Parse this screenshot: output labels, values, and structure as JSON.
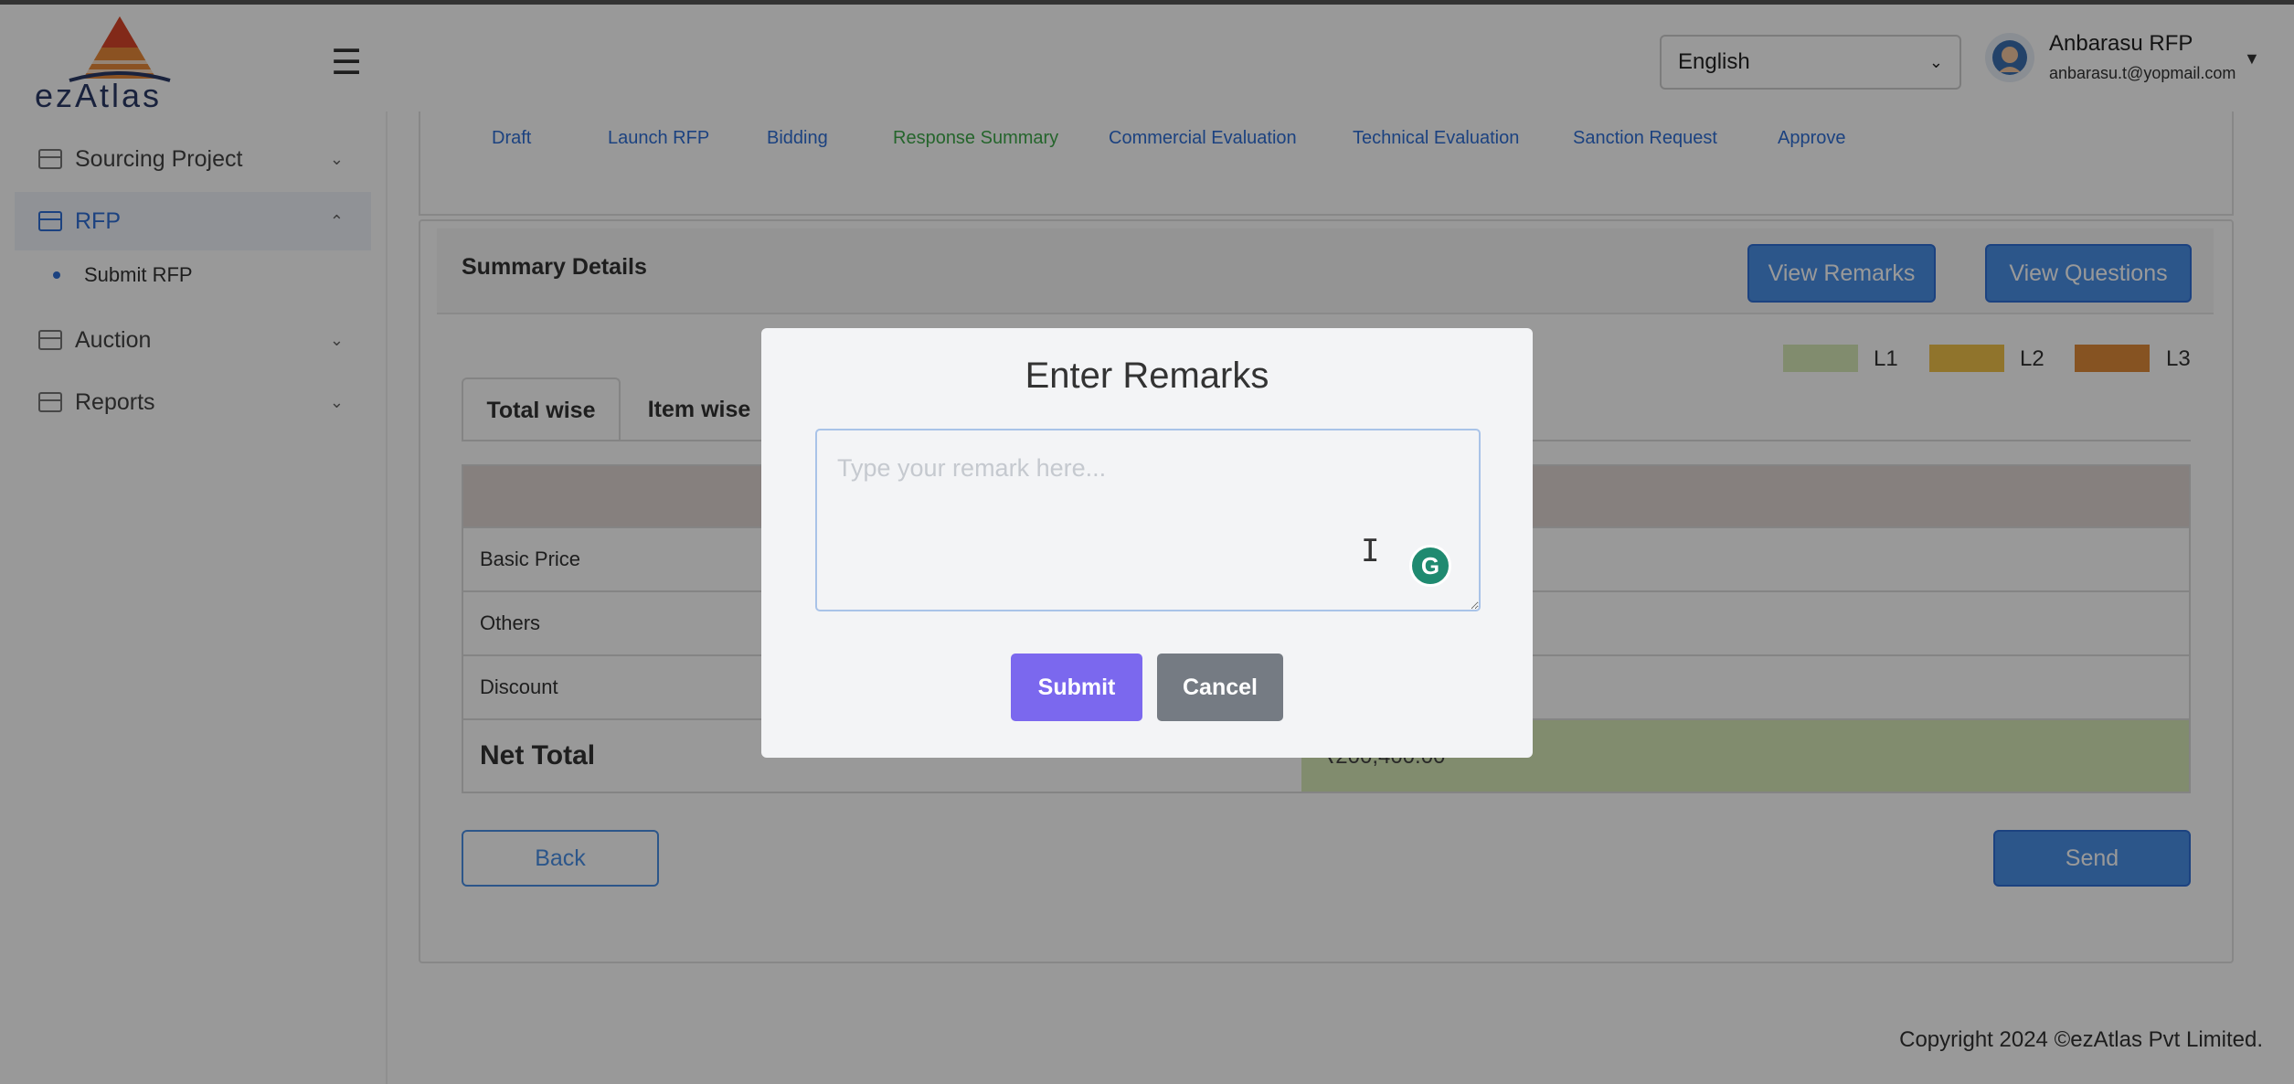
{
  "header": {
    "logo_text": "ezAtlas",
    "language": "English",
    "user_name": "Anbarasu RFP",
    "user_email": "anbarasu.t@yopmail.com"
  },
  "sidebar": {
    "items": [
      {
        "label": "Sourcing Project",
        "icon": "table-icon",
        "chevron": "chevron-down-icon"
      },
      {
        "label": "RFP",
        "icon": "table-icon",
        "chevron": "chevron-up-icon",
        "active": true
      },
      {
        "label": "Auction",
        "icon": "table-icon",
        "chevron": "chevron-down-icon"
      },
      {
        "label": "Reports",
        "icon": "table-icon",
        "chevron": "chevron-down-icon"
      }
    ],
    "sub_item": "Submit RFP"
  },
  "steps": [
    "Draft",
    "Launch RFP",
    "Bidding",
    "Response Summary",
    "Commercial Evaluation",
    "Technical Evaluation",
    "Sanction Request",
    "Approve"
  ],
  "summary": {
    "title": "Summary Details",
    "view_remarks": "View Remarks",
    "view_questions": "View Questions",
    "legend": [
      {
        "label": "L1",
        "color": "#d8eab8"
      },
      {
        "label": "L2",
        "color": "#f0c24a"
      },
      {
        "label": "L3",
        "color": "#e08a3a"
      }
    ],
    "tabs": [
      "Total wise",
      "Item wise"
    ],
    "rows": [
      "Basic Price",
      "Others",
      "Discount"
    ],
    "net_total_label": "Net Total",
    "net_total_value": "₹200,400.00"
  },
  "actions": {
    "back": "Back",
    "send": "Send"
  },
  "footer": "Copyright 2024 ©ezAtlas Pvt Limited.",
  "modal": {
    "title": "Enter Remarks",
    "placeholder": "Type your remark here...",
    "submit": "Submit",
    "cancel": "Cancel"
  },
  "colors": {
    "accent": "#2f6fd6",
    "step_done": "#3ea84a",
    "submit": "#7b68ee",
    "cancel": "#757b83"
  }
}
